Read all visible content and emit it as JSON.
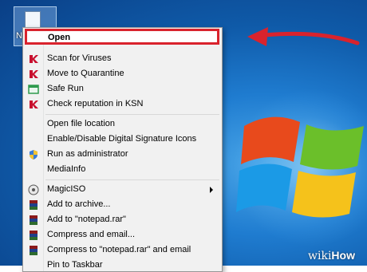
{
  "desktop": {
    "icon_label": "N"
  },
  "menu": {
    "open": "Open",
    "scan": "Scan for Viruses",
    "quarantine": "Move to Quarantine",
    "safe_run": "Safe Run",
    "ksn": "Check reputation in KSN",
    "open_location": "Open file location",
    "signatures": "Enable/Disable Digital Signature Icons",
    "run_admin": "Run as administrator",
    "mediainfo": "MediaInfo",
    "magiciso": "MagicISO",
    "add_archive": "Add to archive...",
    "add_rar": "Add to \"notepad.rar\"",
    "compress_email": "Compress and email...",
    "compress_rar_email": "Compress to \"notepad.rar\" and email",
    "pin_taskbar": "Pin to Taskbar"
  },
  "watermark": {
    "wiki": "wiki",
    "how": "How"
  },
  "colors": {
    "highlight_border": "#d9232d",
    "kaspersky_red": "#c8102e",
    "winrar_red": "#8b1a1a"
  }
}
